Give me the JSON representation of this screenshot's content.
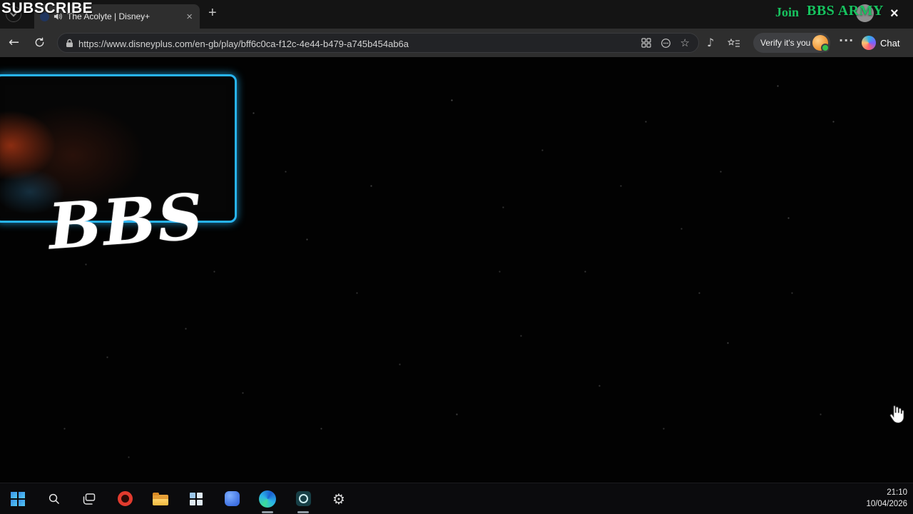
{
  "stream_overlay": {
    "subscribe_label": "SUBSCRIBE",
    "join_label": "Join",
    "army_label": "BBS ARMY",
    "watermark": "BBS"
  },
  "browser": {
    "tab_title": "The Acolyte | Disney+",
    "url": "https://www.disneyplus.com/en-gb/play/bff6c0ca-f12c-4e44-b479-a745b454ab6a",
    "verify_label": "Verify it's you",
    "chat_label": "Chat"
  },
  "icons": {
    "back": "←",
    "new_tab": "+",
    "tab_close": "×",
    "window_close": "×",
    "favorite_star": "☆",
    "media_note": "♪",
    "menu_ellipsis": "···",
    "settings_gear": "⚙"
  },
  "taskbar": {
    "time": "21:10",
    "date": "10/04/2026"
  },
  "colors": {
    "overlay_green": "#17c35f",
    "cam_border": "#27b4f2",
    "toolbar_bg": "#2e2e2e",
    "avatar_orange": "#f09a3a"
  }
}
